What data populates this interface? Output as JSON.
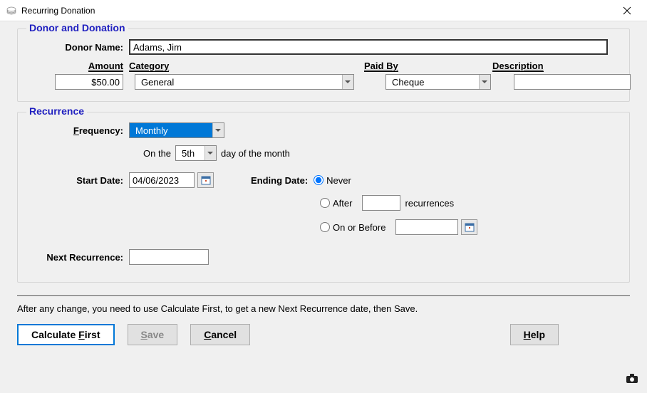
{
  "window": {
    "title": "Recurring Donation"
  },
  "donor": {
    "group_label": "Donor and Donation",
    "name_label": "Donor Name:",
    "name_value": "Adams, Jim",
    "amount_label": "Amount",
    "amount_value": "$50.00",
    "category_label": "Category",
    "category_value": "General",
    "paidby_label": "Paid By",
    "paidby_value": "Cheque",
    "description_label": "Description",
    "description_value": ""
  },
  "recurrence": {
    "group_label": "Recurrence",
    "frequency_label": "Frequency:",
    "frequency_value": "Monthly",
    "on_the_text": "On the",
    "day_value": "5th",
    "day_suffix": "day of the month",
    "start_label": "Start Date:",
    "start_value": "04/06/2023",
    "ending_label": "Ending Date:",
    "never_label": "Never",
    "after_label": "After",
    "after_value": "",
    "after_suffix": "recurrences",
    "onbefore_label": "On or Before",
    "onbefore_value": "",
    "next_label": "Next Recurrence:",
    "next_value": ""
  },
  "note": "After any change, you need to use Calculate First, to get a new Next Recurrence date, then Save.",
  "buttons": {
    "calculate": "Calculate First",
    "save": "Save",
    "cancel": "Cancel",
    "help": "Help"
  }
}
